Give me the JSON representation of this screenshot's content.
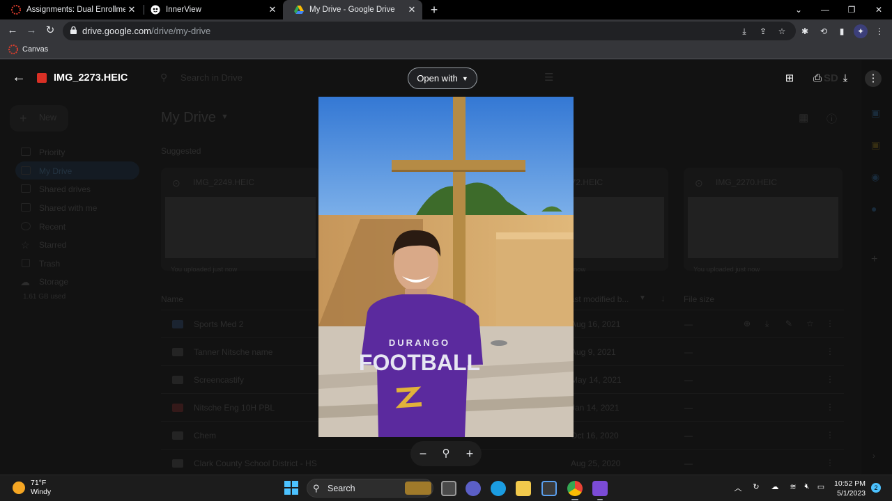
{
  "browser": {
    "tabs": [
      {
        "title": "Assignments: Dual Enrollment - E",
        "active": false
      },
      {
        "title": "InnerView",
        "active": false
      },
      {
        "title": "My Drive - Google Drive",
        "active": true
      }
    ],
    "close_glyph": "✕",
    "new_tab_glyph": "+",
    "url_host": "drive.google.com",
    "url_path": "/drive/my-drive",
    "bookmark": "Canvas"
  },
  "drive": {
    "search_placeholder": "Search in Drive",
    "new_label": "New",
    "nav": [
      "Priority",
      "My Drive",
      "Shared drives",
      "Shared with me",
      "Recent",
      "Starred",
      "Trash",
      "Storage"
    ],
    "storage_used": "1.61 GB used",
    "heading": "My Drive",
    "suggested": "Suggested",
    "cards": [
      {
        "name": "IMG_2249.HEIC",
        "note": "You uploaded just now"
      },
      {
        "name": "IMG_2272.HEIC",
        "note": "You uploaded just now"
      },
      {
        "name": "IMG_2270.HEIC",
        "note": "You uploaded just now"
      }
    ],
    "columns": {
      "name": "Name",
      "modified": "Last modified b...",
      "size": "File size"
    },
    "rows": [
      {
        "name": "Sports Med 2",
        "modified": "Aug 16, 2021",
        "size": "—"
      },
      {
        "name": "Tanner Nitsche name",
        "modified": "Aug 9, 2021",
        "size": "—"
      },
      {
        "name": "Screencastify",
        "modified": "May 14, 2021",
        "size": "—"
      },
      {
        "name": "Nitsche Eng 10H PBL",
        "modified": "Jan 14, 2021",
        "size": "—"
      },
      {
        "name": "Chem",
        "modified": "Oct 16, 2020",
        "size": "—"
      },
      {
        "name": "Clark County School District - HS",
        "modified": "Aug 25, 2020",
        "size": "—"
      }
    ]
  },
  "viewer": {
    "file_name": "IMG_2273.HEIC",
    "open_with": "Open with",
    "shirt_line1": "DURANGO",
    "shirt_line2": "FOOTBALL"
  },
  "taskbar": {
    "temp": "71°F",
    "condition": "Windy",
    "search_label": "Search",
    "time": "10:52 PM",
    "date": "5/1/2023",
    "notifications": "2"
  },
  "colors": {
    "accent": "#4cc2ff",
    "sky": "#3f86d8",
    "wall": "#d6aa6a",
    "shirt": "#5b2a9e"
  }
}
